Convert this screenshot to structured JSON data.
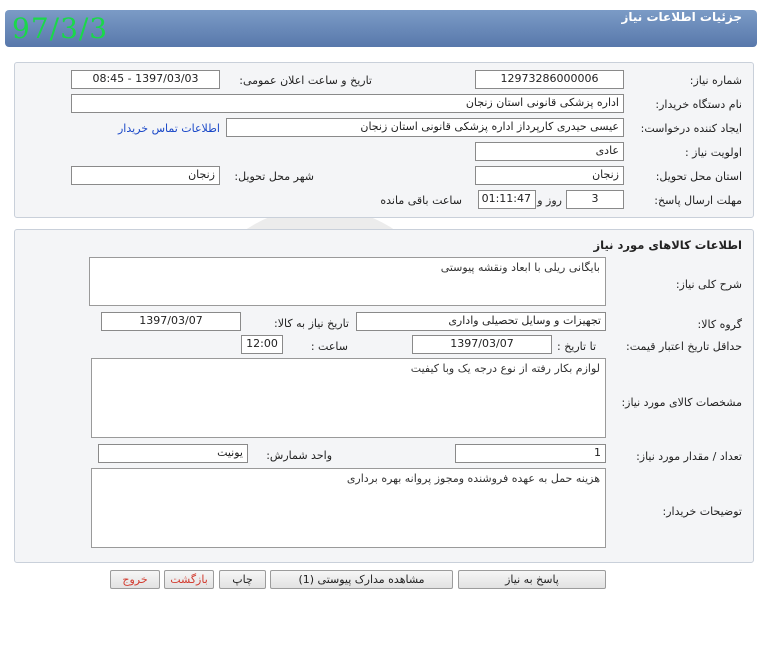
{
  "overlay_date": "97/3/3",
  "header": {
    "title": "جزئیات اطلاعات نیاز"
  },
  "info": {
    "need_number_label": "شماره نیاز:",
    "need_number": "12973286000006",
    "announce_label": "تاریخ و ساعت اعلان عمومی:",
    "announce_value": "1397/03/03 - 08:45",
    "buyer_org_label": "نام دستگاه خریدار:",
    "buyer_org": "اداره پزشکی قانونی استان زنجان",
    "requester_label": "ایجاد کننده درخواست:",
    "requester": "عیسی حیدری کارپرداز اداره پزشکی قانونی استان زنجان",
    "contact_link": "اطلاعات تماس خریدار",
    "priority_label": "اولویت نیاز :",
    "priority": "عادی",
    "province_label": "استان محل تحویل:",
    "province": "زنجان",
    "city_label": "شهر محل تحویل:",
    "city": "زنجان",
    "deadline_label": "مهلت ارسال پاسخ:",
    "days": "3",
    "days_label": "روز و",
    "time_remaining": "01:11:47",
    "remaining_label": "ساعت باقی مانده"
  },
  "goods": {
    "section_title": "اطلاعات کالاهای مورد نیاز",
    "desc_label": "شرح کلی نیاز:",
    "desc": "بایگانی ریلی با ابعاد ونقشه پیوستی",
    "group_label": "گروه کالا:",
    "group": "تجهیزات و وسایل تحصیلی واداری",
    "need_date_label": "تاریخ نیاز به کالا:",
    "need_date": "1397/03/07",
    "min_price_label": "حداقل تاریخ اعتبار قیمت:",
    "to_date_label": "تا تاریخ :",
    "to_date": "1397/03/07",
    "hour_label": "ساعت :",
    "hour": "12:00",
    "specs_label": "مشخصات کالای مورد نیاز:",
    "specs": "لوازم بکار رفته از نوع درجه یک وبا کیفیت",
    "qty_label": "تعداد / مقدار مورد نیاز:",
    "qty": "1",
    "unit_label": "واحد شمارش:",
    "unit": "یونیت",
    "buyer_notes_label": "توضیحات خریدار:",
    "buyer_notes": "هزینه حمل به عهده فروشنده ومجوز پروانه بهره برداری"
  },
  "buttons": {
    "reply": "پاسخ به نیاز",
    "attachments": "مشاهده مدارک پیوستی (1)",
    "print": "چاپ",
    "back": "بازگشت",
    "exit": "خروج"
  },
  "colors": {
    "header": "#6a89b8",
    "overlay_date": "#1ad84a",
    "link": "#1a48c8",
    "danger": "#d23a2e"
  }
}
